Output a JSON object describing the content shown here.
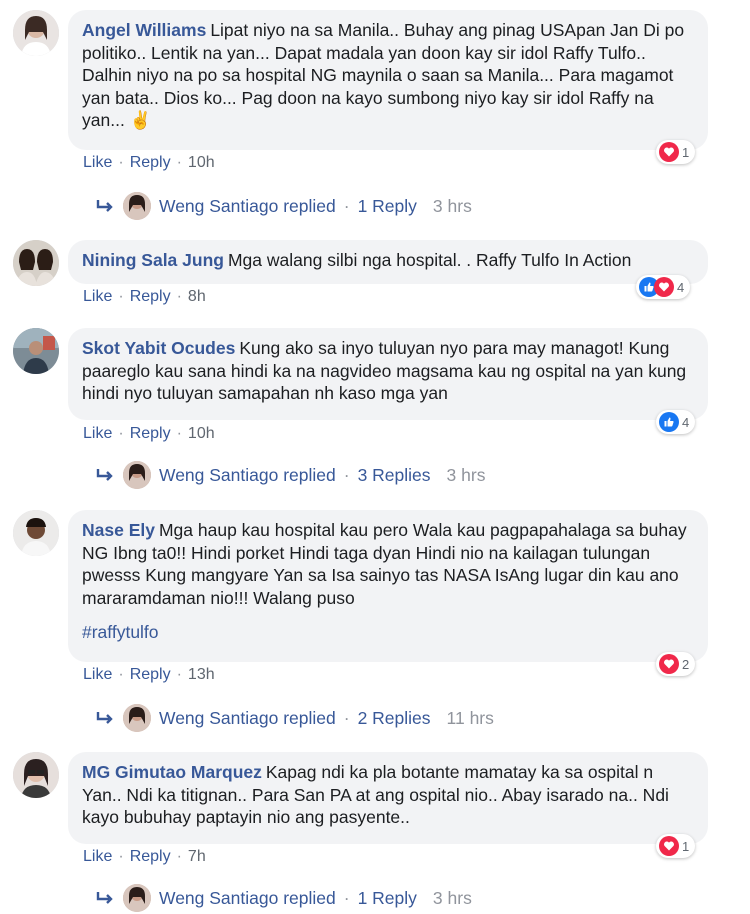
{
  "actions": {
    "like": "Like",
    "reply": "Reply",
    "dot": "·"
  },
  "comments": [
    {
      "author": "Angel Williams",
      "text": "Lipat niyo na sa Manila.. Buhay ang pinag USApan Jan Di po politiko.. Lentik na yan... Dapat madala yan doon kay sir idol Raffy Tulfo.. Dalhin niyo na po sa hospital NG maynila o saan sa Manila... Para magamot yan bata.. Dios ko... Pag doon na kayo sumbong niyo kay sir idol Raffy na yan...",
      "emoji": "✌️",
      "time": "10h",
      "reactions": {
        "icons": [
          "love-icon"
        ],
        "count": "1"
      },
      "reply": {
        "name": "Weng Santiago replied",
        "count": "1 Reply",
        "time": "3 hrs"
      }
    },
    {
      "author": "Nining Sala Jung",
      "text": "Mga walang silbi nga hospital. . Raffy Tulfo In Action",
      "time": "8h",
      "reactions": {
        "icons": [
          "like-icon",
          "love-icon"
        ],
        "count": "4"
      }
    },
    {
      "author": "Skot Yabit Ocudes",
      "text": "Kung ako sa inyo tuluyan nyo para may managot! Kung paareglo kau sana hindi ka na nagvideo magsama kau ng ospital na yan kung hindi nyo tuluyan samapahan nh kaso mga yan",
      "time": "10h",
      "reactions": {
        "icons": [
          "like-icon"
        ],
        "count": "4"
      },
      "reply": {
        "name": "Weng Santiago replied",
        "count": "3 Replies",
        "time": "3 hrs"
      }
    },
    {
      "author": "Nase Ely",
      "text": "Mga haup kau hospital kau pero Wala kau pagpapahalaga sa buhay NG Ibng ta0!! Hindi porket Hindi taga dyan Hindi nio na kailagan tulungan pwesss Kung mangyare Yan sa Isa sainyo tas NASA IsAng lugar din kau ano mararamdaman nio!!! Walang puso",
      "hashtag": "#raffytulfo",
      "time": "13h",
      "reactions": {
        "icons": [
          "love-icon"
        ],
        "count": "2"
      },
      "reply": {
        "name": "Weng Santiago replied",
        "count": "2 Replies",
        "time": "11 hrs"
      }
    },
    {
      "author": "MG Gimutao Marquez",
      "text": "Kapag ndi ka pla botante mamatay ka sa ospital n Yan.. Ndi ka titignan.. Para San PA at ang ospital nio.. Abay isarado na.. Ndi kayo bubuhay paptayin nio ang pasyente..",
      "time": "7h",
      "reactions": {
        "icons": [
          "love-icon"
        ],
        "count": "1"
      },
      "reply": {
        "name": "Weng Santiago replied",
        "count": "1 Reply",
        "time": "3 hrs"
      }
    }
  ],
  "colors": {
    "link": "#385898",
    "bubble": "#f2f3f5",
    "love": "#f0284a",
    "like": "#1877f2"
  }
}
